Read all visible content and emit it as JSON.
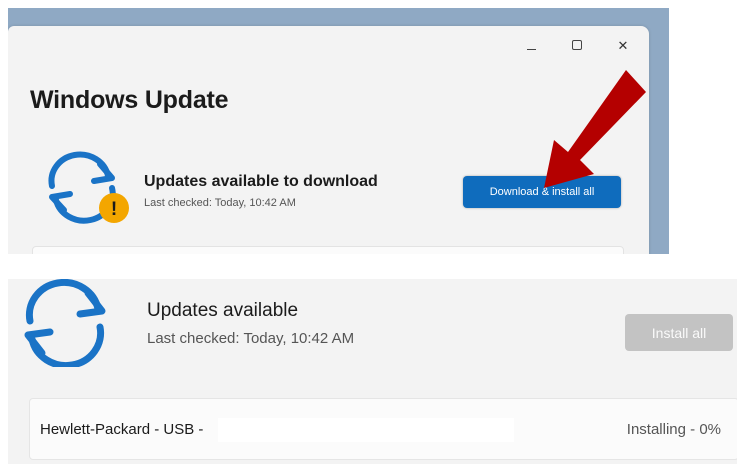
{
  "top_window": {
    "title": "Windows Update",
    "status_heading": "Updates available to download",
    "status_subtext": "Last checked: Today, 10:42 AM",
    "primary_button": "Download & install all",
    "controls": {
      "minimize": "–",
      "maximize": "",
      "close": "✕"
    },
    "badge_symbol": "!"
  },
  "bottom_panel": {
    "status_heading": "Updates available",
    "status_subtext": "Last checked: Today, 10:42 AM",
    "primary_button": "Install all",
    "updates": [
      {
        "name": "Hewlett-Packard - USB - ",
        "state": "Installing - 0%"
      }
    ]
  },
  "colors": {
    "accent_blue": "#0f6cbd",
    "sync_icon_blue": "#1a73c6",
    "warning_badge": "#f3a600",
    "arrow_red": "#b40000",
    "disabled_button": "#c3c3c3"
  },
  "icons": [
    "sync-icon",
    "warning-badge-icon",
    "minimize-icon",
    "maximize-icon",
    "close-icon",
    "annotation-arrow"
  ]
}
